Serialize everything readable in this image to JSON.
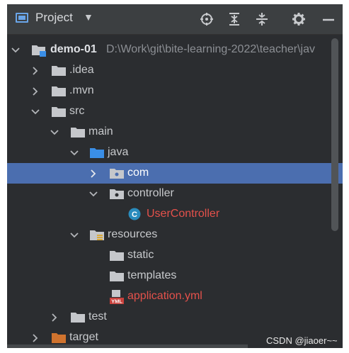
{
  "header": {
    "title": "Project",
    "caret_icon": "caret-down-icon",
    "buttons": [
      "locate-icon",
      "expand-all-icon",
      "collapse-all-icon",
      "gear-icon",
      "minimize-icon"
    ]
  },
  "tree": {
    "root": {
      "name": "demo-01",
      "path": "D:\\Work\\git\\bite-learning-2022\\teacher\\jav"
    },
    "items": [
      {
        "name": ".idea",
        "icon": "folder-icon"
      },
      {
        "name": ".mvn",
        "icon": "folder-icon"
      },
      {
        "name": "src",
        "icon": "folder-icon"
      },
      {
        "name": "main",
        "icon": "folder-icon"
      },
      {
        "name": "java",
        "icon": "source-folder-icon"
      },
      {
        "name": "com",
        "icon": "package-icon"
      },
      {
        "name": "controller",
        "icon": "package-icon"
      },
      {
        "name": "UserController",
        "icon": "class-icon"
      },
      {
        "name": "resources",
        "icon": "resources-folder-icon"
      },
      {
        "name": "static",
        "icon": "folder-icon"
      },
      {
        "name": "templates",
        "icon": "folder-icon"
      },
      {
        "name": "application.yml",
        "icon": "yml-file-icon"
      },
      {
        "name": "test",
        "icon": "folder-icon"
      },
      {
        "name": "target",
        "icon": "excluded-folder-icon"
      }
    ],
    "yml_badge": "YML",
    "class_badge": "C"
  },
  "watermark": "CSDN @jiaoer~~",
  "colors": {
    "background": "#2b2d30",
    "selection": "#4b6eaf",
    "error_text": "#e4514b",
    "folder": "#c5c7cb",
    "source_folder": "#3a8ee6",
    "target_folder": "#d0732e"
  }
}
